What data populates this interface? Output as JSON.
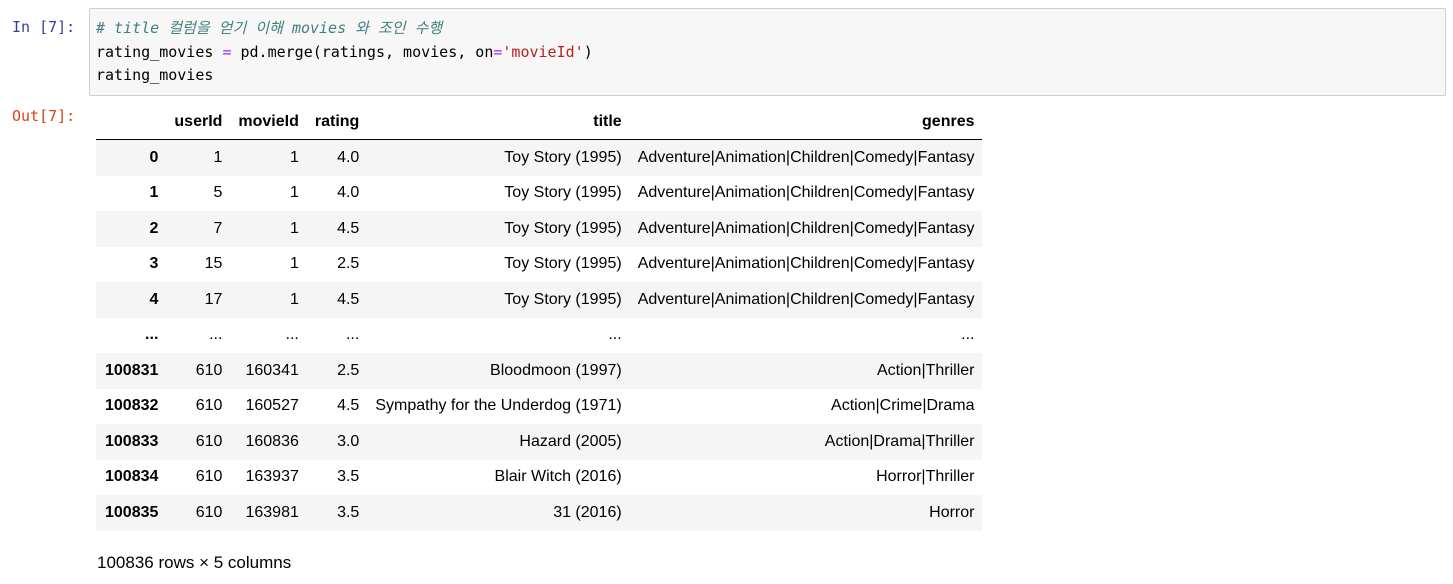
{
  "cell": {
    "in_prompt": "In [7]:",
    "out_prompt": "Out[7]:",
    "code": {
      "comment": "# title 컬럼을 얻기 이해 movies 와 조인 수행",
      "line2_var": "rating_movies ",
      "line2_eq": "=",
      "line2_call": " pd.merge(ratings, movies, on",
      "line2_eq2": "=",
      "line2_str": "'movieId'",
      "line2_close": ")",
      "line3": "rating_movies"
    }
  },
  "table": {
    "columns": [
      "",
      "userId",
      "movieId",
      "rating",
      "title",
      "genres"
    ],
    "rows": [
      [
        "0",
        "1",
        "1",
        "4.0",
        "Toy Story (1995)",
        "Adventure|Animation|Children|Comedy|Fantasy"
      ],
      [
        "1",
        "5",
        "1",
        "4.0",
        "Toy Story (1995)",
        "Adventure|Animation|Children|Comedy|Fantasy"
      ],
      [
        "2",
        "7",
        "1",
        "4.5",
        "Toy Story (1995)",
        "Adventure|Animation|Children|Comedy|Fantasy"
      ],
      [
        "3",
        "15",
        "1",
        "2.5",
        "Toy Story (1995)",
        "Adventure|Animation|Children|Comedy|Fantasy"
      ],
      [
        "4",
        "17",
        "1",
        "4.5",
        "Toy Story (1995)",
        "Adventure|Animation|Children|Comedy|Fantasy"
      ],
      [
        "...",
        "...",
        "...",
        "...",
        "...",
        "..."
      ],
      [
        "100831",
        "610",
        "160341",
        "2.5",
        "Bloodmoon (1997)",
        "Action|Thriller"
      ],
      [
        "100832",
        "610",
        "160527",
        "4.5",
        "Sympathy for the Underdog (1971)",
        "Action|Crime|Drama"
      ],
      [
        "100833",
        "610",
        "160836",
        "3.0",
        "Hazard (2005)",
        "Action|Drama|Thriller"
      ],
      [
        "100834",
        "610",
        "163937",
        "3.5",
        "Blair Witch (2016)",
        "Horror|Thriller"
      ],
      [
        "100835",
        "610",
        "163981",
        "3.5",
        "31 (2016)",
        "Horror"
      ]
    ]
  },
  "shape_note": "100836 rows × 5 columns"
}
